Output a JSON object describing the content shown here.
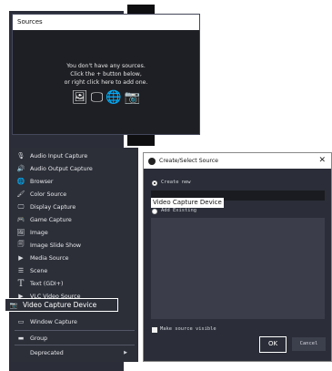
{
  "sources_panel": {
    "title": "Sources",
    "empty_line1": "You don't have any sources.",
    "empty_line2": "Click the + button below,",
    "empty_line3": "or right click here to add one."
  },
  "menu": {
    "items": [
      {
        "label": "Audio Input Capture",
        "icon": "microphone-icon",
        "glyph": "🎙"
      },
      {
        "label": "Audio Output Capture",
        "icon": "speaker-icon",
        "glyph": "🔊"
      },
      {
        "label": "Browser",
        "icon": "globe-icon",
        "glyph": "🌐"
      },
      {
        "label": "Color Source",
        "icon": "brush-icon",
        "glyph": "🖌"
      },
      {
        "label": "Display Capture",
        "icon": "monitor-icon",
        "glyph": "🖵"
      },
      {
        "label": "Game Capture",
        "icon": "gamepad-icon",
        "glyph": "🎮"
      },
      {
        "label": "Image",
        "icon": "image-icon",
        "glyph": "🖼"
      },
      {
        "label": "Image Slide Show",
        "icon": "slideshow-icon",
        "glyph": "🗐"
      },
      {
        "label": "Media Source",
        "icon": "play-icon",
        "glyph": "▶"
      },
      {
        "label": "Scene",
        "icon": "list-icon",
        "glyph": "☰"
      },
      {
        "label": "Text (GDI+)",
        "icon": "text-icon",
        "glyph": "T"
      },
      {
        "label": "VLC Video Source",
        "icon": "play-icon",
        "glyph": "▶"
      },
      {
        "label": "Video Capture Device",
        "icon": "camera-icon",
        "glyph": "📷"
      },
      {
        "label": "Window Capture",
        "icon": "window-icon",
        "glyph": "▭"
      },
      {
        "label": "Group",
        "icon": "folder-icon",
        "glyph": "▬"
      },
      {
        "label": "Deprecated",
        "icon": "",
        "glyph": ""
      }
    ]
  },
  "dialog": {
    "title": "Create/Select Source",
    "create_new_label": "Create new",
    "name_value": "Video Capture Device",
    "add_existing_label": "Add Existing",
    "make_visible_label": "Make source visible",
    "ok_label": "OK",
    "cancel_label": "Cancel"
  }
}
